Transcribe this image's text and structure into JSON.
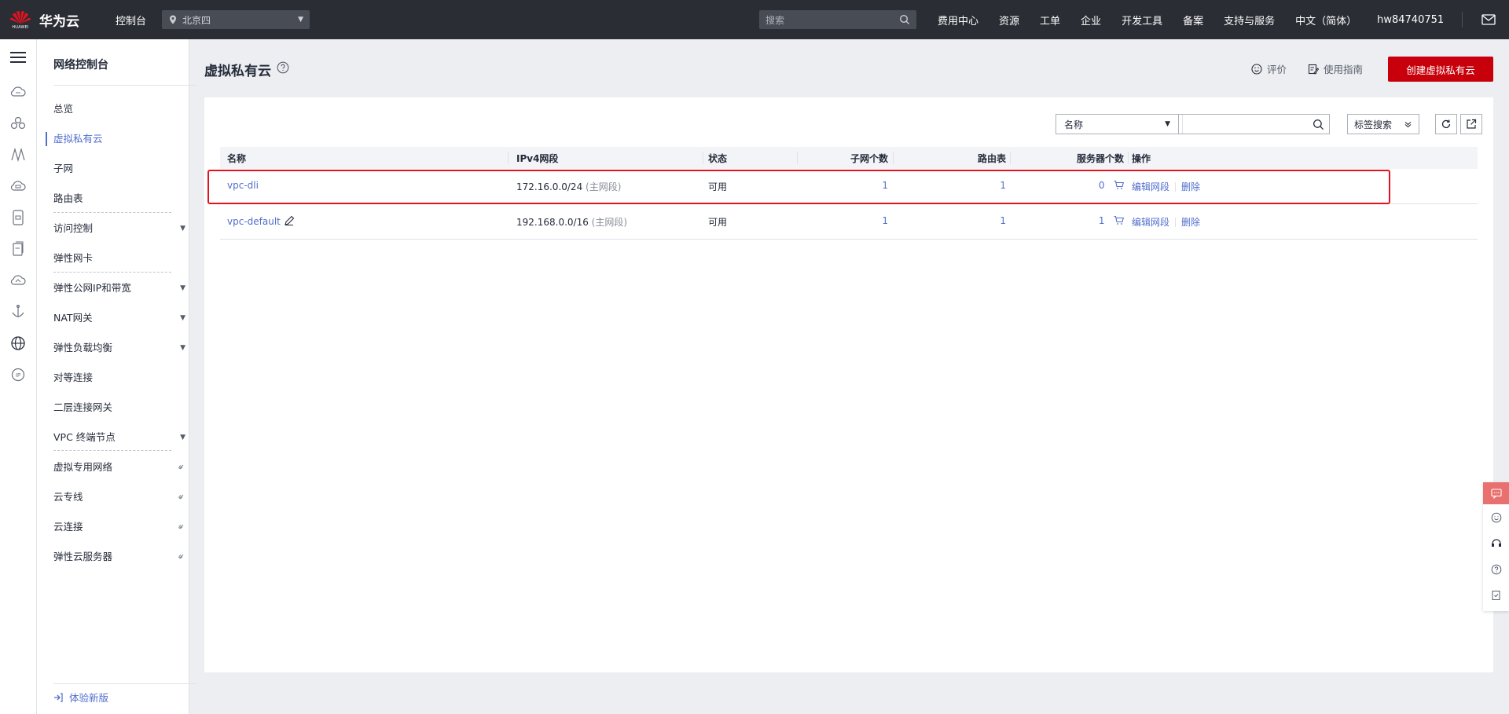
{
  "topbar": {
    "logo_small": "HUAWEI",
    "brand": "华为云",
    "console": "控制台",
    "region": "北京四",
    "search_placeholder": "搜索",
    "nav": [
      "费用中心",
      "资源",
      "工单",
      "企业",
      "开发工具",
      "备案",
      "支持与服务",
      "中文（简体）",
      "hw84740751"
    ]
  },
  "sidebar": {
    "title": "网络控制台",
    "items": [
      {
        "label": "总览"
      },
      {
        "label": "虚拟私有云"
      },
      {
        "label": "子网"
      },
      {
        "label": "路由表"
      },
      {
        "label": "访问控制"
      },
      {
        "label": "弹性网卡"
      },
      {
        "label": "弹性公网IP和带宽"
      },
      {
        "label": "NAT网关"
      },
      {
        "label": "弹性负载均衡"
      },
      {
        "label": "对等连接"
      },
      {
        "label": "二层连接网关"
      },
      {
        "label": "VPC 终端节点"
      },
      {
        "label": "虚拟专用网络"
      },
      {
        "label": "云专线"
      },
      {
        "label": "云连接"
      },
      {
        "label": "弹性云服务器"
      }
    ],
    "footer": "体验新版"
  },
  "main": {
    "title": "虚拟私有云",
    "rate": "评价",
    "guide": "使用指南",
    "create_button": "创建虚拟私有云"
  },
  "filter": {
    "field": "名称",
    "search_value": "",
    "tag_search": "标签搜索"
  },
  "table": {
    "headers": [
      "名称",
      "IPv4网段",
      "状态",
      "子网个数",
      "路由表",
      "服务器个数",
      "操作"
    ],
    "rows": [
      {
        "name": "vpc-dli",
        "cidr": "172.16.0.0/24",
        "cidr_note": "(主网段)",
        "status": "可用",
        "subnets": "1",
        "route_tables": "1",
        "servers": "0",
        "op_edit": "编辑网段",
        "op_delete": "删除"
      },
      {
        "name": "vpc-default",
        "cidr": "192.168.0.0/16",
        "cidr_note": "(主网段)",
        "status": "可用",
        "subnets": "1",
        "route_tables": "1",
        "servers": "1",
        "op_edit": "编辑网段",
        "op_delete": "删除"
      }
    ]
  },
  "colors": {
    "brand_red": "#c7000b",
    "link": "#526ecc",
    "topbar": "#2a2d34",
    "highlight": "#e3121e"
  }
}
